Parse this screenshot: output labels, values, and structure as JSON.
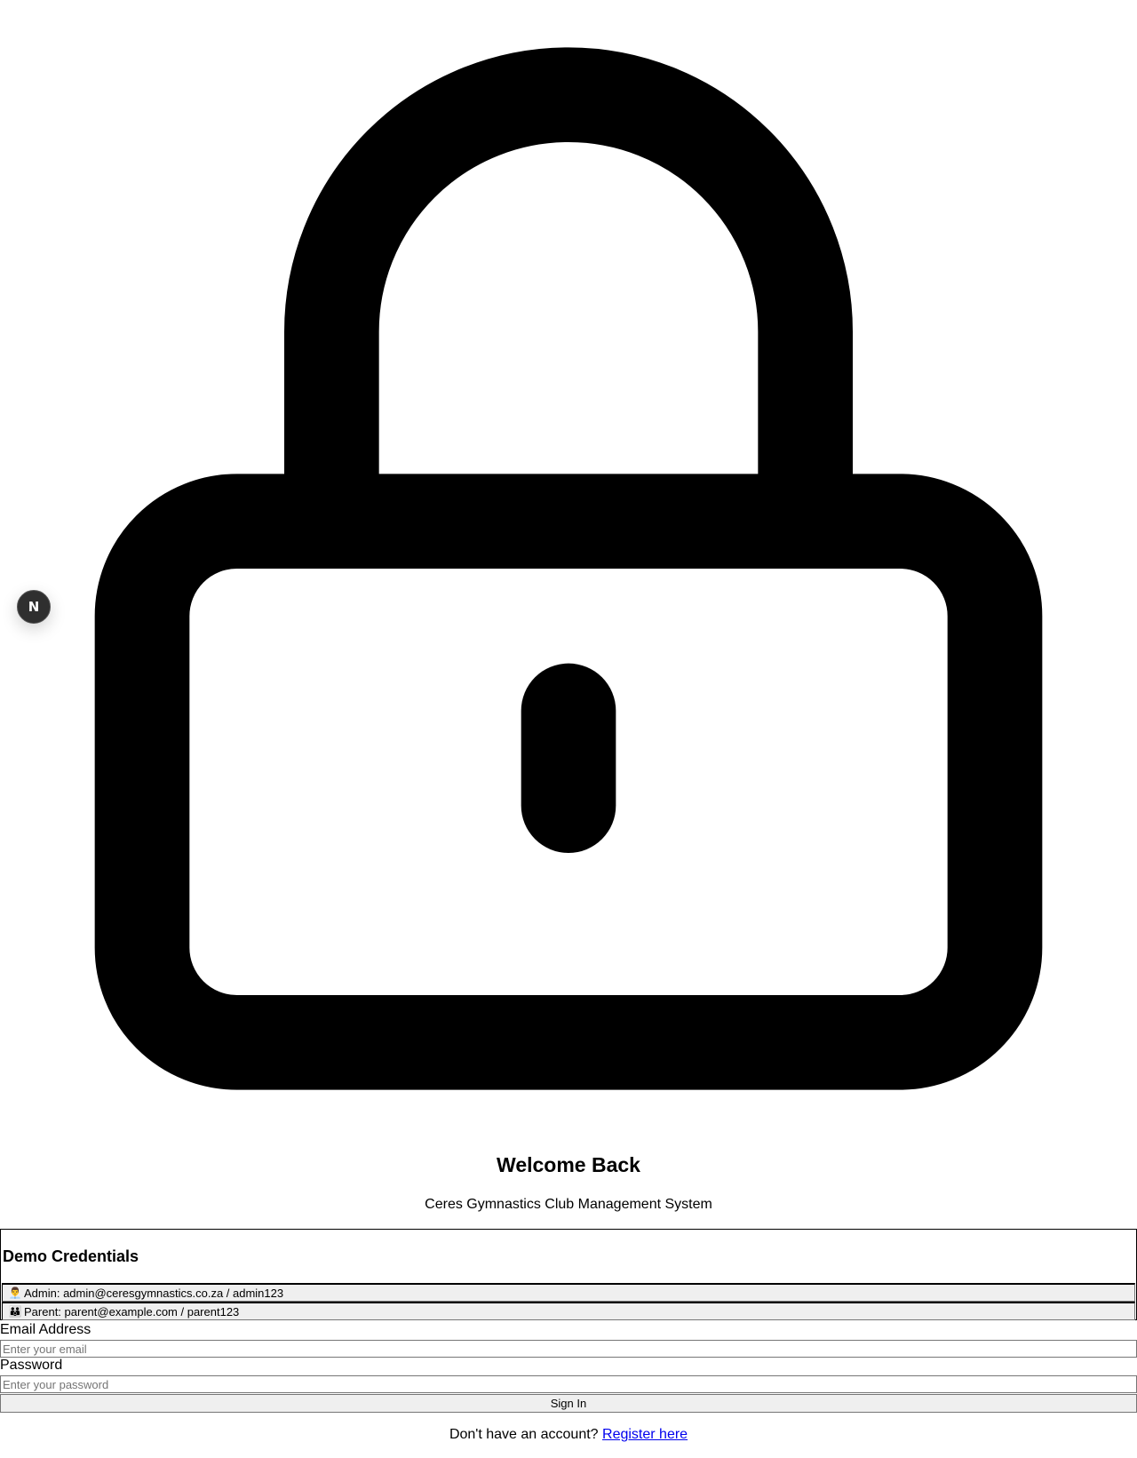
{
  "hero": {
    "icon": "lock-icon"
  },
  "dev_badge": {
    "icon": "nextjs-icon",
    "letter": "N"
  },
  "header": {
    "title": "Welcome Back",
    "subtitle": "Ceres Gymnastics Club Management System"
  },
  "demo": {
    "title": "Demo Credentials",
    "admin": {
      "icon": "👨‍💼",
      "label": "Admin: admin@ceresgymnastics.co.za / admin123"
    },
    "parent": {
      "icon": "👪",
      "label": "Parent: parent@example.com / parent123"
    }
  },
  "form": {
    "email_label": "Email Address",
    "email_placeholder": "Enter your email",
    "email_value": "",
    "password_label": "Password",
    "password_placeholder": "Enter your password",
    "password_value": "",
    "submit_label": "Sign In"
  },
  "footer": {
    "prompt": "Don't have an account?",
    "link_label": "Register here"
  },
  "colors": {
    "link": "#0000ee",
    "button_bg": "#efefef",
    "badge_bg": "#2f2f2f"
  }
}
